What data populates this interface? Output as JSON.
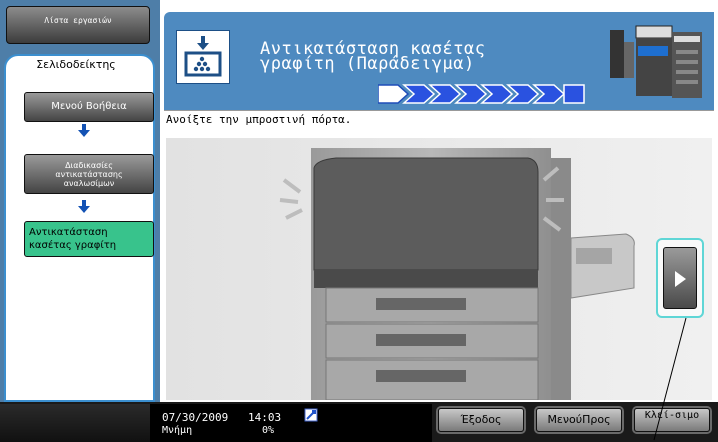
{
  "left_panel": {
    "jobs_button": "Λίστα εργασιών",
    "bookmark_title": "Σελιδοδείκτης",
    "nav_items": [
      {
        "label": "Μενού Βοήθεια"
      },
      {
        "label": "Διαδικασίες αντικατάστασης αναλωσίμων"
      },
      {
        "label": "Αντικατάσταση κασέτας γραφίτη"
      }
    ]
  },
  "header": {
    "title_line1": "Αντικατάσταση κασέτας",
    "title_line2": "γραφίτη (Παράδειγμα)"
  },
  "content": {
    "instruction": "Ανοίξτε την μπροστινή πόρτα."
  },
  "status": {
    "date": "07/30/2009",
    "time": "14:03",
    "memory_label": "Μνήμη",
    "memory_value": "0%"
  },
  "buttons": {
    "exit": "Έξοδος",
    "menu": "ΜενούΠρος",
    "close": "Κλεί-σιμο"
  },
  "colors": {
    "header_blue": "#4e8ac0",
    "active_green": "#38c38c",
    "highlight_cyan": "#5fd6d6"
  }
}
